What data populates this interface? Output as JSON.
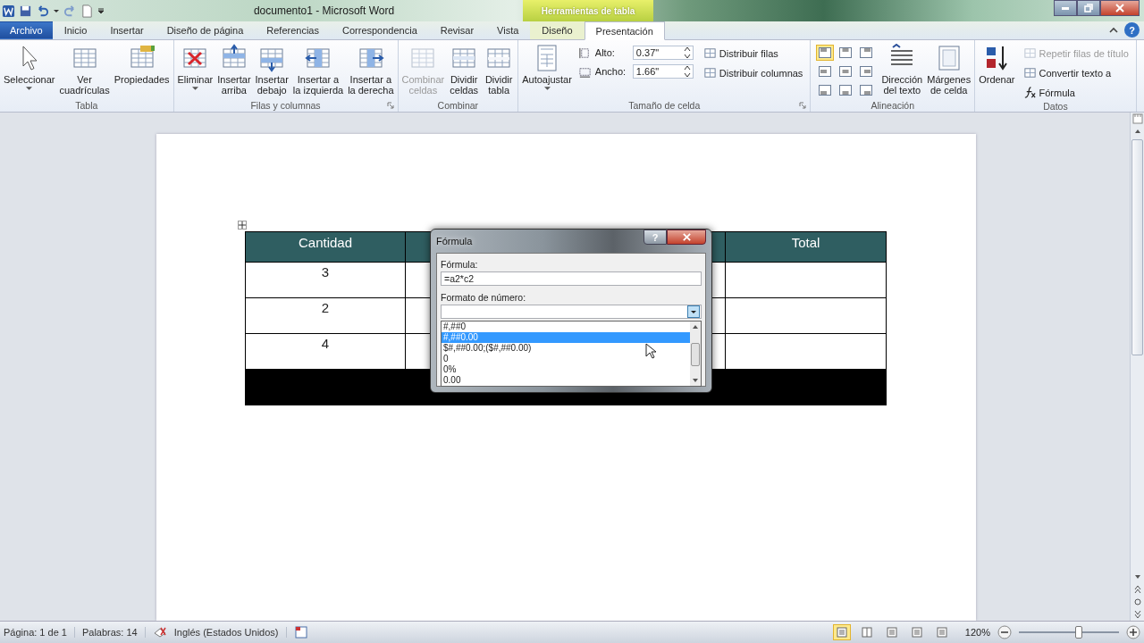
{
  "title_bar": {
    "title": "documento1  -  Microsoft Word",
    "context_header": "Herramientas de tabla"
  },
  "tabs": [
    {
      "label": "Archivo",
      "kind": "file",
      "selected": false
    },
    {
      "label": "Inicio",
      "kind": "normal",
      "selected": false
    },
    {
      "label": "Insertar",
      "kind": "normal",
      "selected": false
    },
    {
      "label": "Diseño de página",
      "kind": "normal",
      "selected": false
    },
    {
      "label": "Referencias",
      "kind": "normal",
      "selected": false
    },
    {
      "label": "Correspondencia",
      "kind": "normal",
      "selected": false
    },
    {
      "label": "Revisar",
      "kind": "normal",
      "selected": false
    },
    {
      "label": "Vista",
      "kind": "normal",
      "selected": false
    },
    {
      "label": "Diseño",
      "kind": "context",
      "selected": false
    },
    {
      "label": "Presentación",
      "kind": "context",
      "selected": true
    }
  ],
  "help_button": "?",
  "ribbon_groups": [
    {
      "label": "Tabla",
      "launcher": false,
      "items": [
        {
          "kind": "large",
          "label": "Seleccionar",
          "dropdown": true,
          "disabled": false
        },
        {
          "kind": "large",
          "label": "Ver\ncuadrículas",
          "dropdown": false,
          "disabled": false
        },
        {
          "kind": "large",
          "label": "Propiedades",
          "dropdown": false,
          "disabled": false
        }
      ]
    },
    {
      "label": "Filas y columnas",
      "launcher": true,
      "items": [
        {
          "kind": "large",
          "label": "Eliminar",
          "dropdown": true,
          "disabled": false
        },
        {
          "kind": "large",
          "label": "Insertar\narriba",
          "dropdown": false,
          "disabled": false
        },
        {
          "kind": "large",
          "label": "Insertar\ndebajo",
          "dropdown": false,
          "disabled": false
        },
        {
          "kind": "large",
          "label": "Insertar a\nla izquierda",
          "dropdown": false,
          "disabled": false
        },
        {
          "kind": "large",
          "label": "Insertar a\nla derecha",
          "dropdown": false,
          "disabled": false
        }
      ]
    },
    {
      "label": "Combinar",
      "launcher": false,
      "items": [
        {
          "kind": "large",
          "label": "Combinar\nceldas",
          "dropdown": false,
          "disabled": true
        },
        {
          "kind": "large",
          "label": "Dividir\nceldas",
          "dropdown": false,
          "disabled": false
        },
        {
          "kind": "large",
          "label": "Dividir\ntabla",
          "dropdown": false,
          "disabled": false
        }
      ]
    },
    {
      "label": "Tamaño de celda",
      "launcher": true,
      "items": [
        {
          "kind": "large",
          "label": "Autoajustar",
          "dropdown": true,
          "disabled": false
        },
        {
          "kind": "stack",
          "items": [
            {
              "kind": "spin",
              "label": "Alto:",
              "value": "0.37\""
            },
            {
              "kind": "spin",
              "label": "Ancho:",
              "value": "1.66\""
            }
          ]
        },
        {
          "kind": "stack",
          "items": [
            {
              "kind": "small",
              "label": "Distribuir filas",
              "disabled": false
            },
            {
              "kind": "small",
              "label": "Distribuir columnas",
              "disabled": false
            }
          ]
        }
      ]
    },
    {
      "label": "Alineación",
      "launcher": false,
      "items": [
        {
          "kind": "align_grid",
          "cells": [
            {
              "selected": true
            },
            {
              "selected": false
            },
            {
              "selected": false
            },
            {
              "selected": false
            },
            {
              "selected": false
            },
            {
              "selected": false
            },
            {
              "selected": false
            },
            {
              "selected": false
            },
            {
              "selected": false
            }
          ]
        },
        {
          "kind": "large",
          "label": "Dirección\ndel texto",
          "dropdown": false,
          "disabled": false
        },
        {
          "kind": "large",
          "label": "Márgenes\nde celda",
          "dropdown": false,
          "disabled": false
        }
      ]
    },
    {
      "label": "Datos",
      "launcher": false,
      "items": [
        {
          "kind": "large",
          "label": "Ordenar",
          "dropdown": false,
          "disabled": false
        },
        {
          "kind": "stack",
          "items": [
            {
              "kind": "small",
              "label": "Repetir filas de título",
              "disabled": true
            },
            {
              "kind": "small",
              "label": "Convertir texto a",
              "disabled": false
            },
            {
              "kind": "small",
              "label": "Fórmula",
              "disabled": false
            }
          ]
        }
      ]
    }
  ],
  "table": {
    "columns": [
      {
        "header": "Cantidad"
      },
      {},
      {},
      {
        "header": "Total"
      }
    ],
    "rows": [
      {
        "kind": "data",
        "cells": [
          "3"
        ]
      },
      {
        "kind": "data",
        "cells": [
          "2"
        ]
      },
      {
        "kind": "data",
        "cells": [
          "4"
        ]
      },
      {
        "kind": "total"
      }
    ]
  },
  "dialog": {
    "title": "Fórmula",
    "help_button": "?",
    "formula_label": "Fórmula:",
    "formula_value": "=a2*c2",
    "format_label": "Formato de número:",
    "format_options": [
      {
        "label": "#,##0",
        "selected": false
      },
      {
        "label": "#,##0.00",
        "selected": true
      },
      {
        "label": "$#,##0.00;($#,##0.00)",
        "selected": false
      },
      {
        "label": "0",
        "selected": false
      },
      {
        "label": "0%",
        "selected": false
      },
      {
        "label": "0.00",
        "selected": false
      }
    ]
  },
  "status_bar": {
    "page": "Página: 1 de 1",
    "words": "Palabras: 14",
    "language": "Inglés (Estados Unidos)",
    "views": [
      {
        "selected": true
      },
      {
        "selected": false
      },
      {
        "selected": false
      },
      {
        "selected": false
      },
      {
        "selected": false
      }
    ],
    "zoom": "120%",
    "zoom_slider": {
      "level": 0.6
    }
  }
}
